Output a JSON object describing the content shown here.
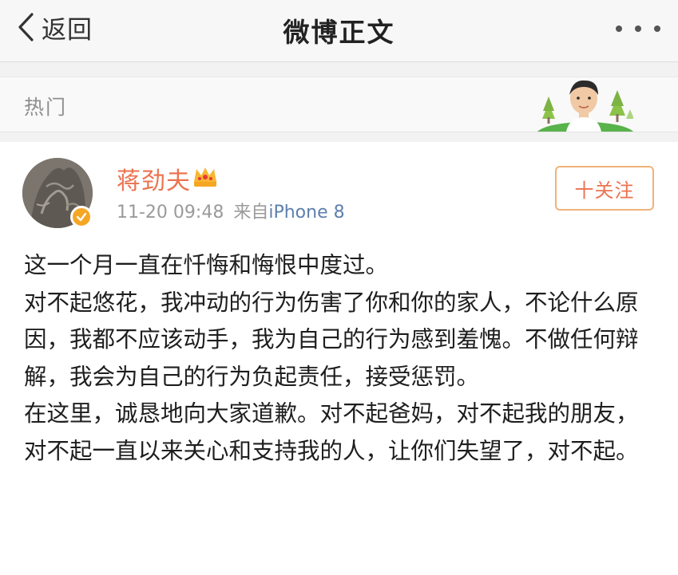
{
  "navbar": {
    "back_label": "返回",
    "title": "微博正文",
    "more_icon": "more-dots-icon"
  },
  "hot": {
    "label": "热门"
  },
  "post": {
    "author": "蒋劲夫",
    "timestamp": "11-20 09:48",
    "source_prefix": "来自",
    "source_name": "iPhone 8",
    "follow_label": "十关注",
    "paragraphs": [
      "这一个月一直在忏悔和悔恨中度过。",
      "对不起悠花，我冲动的行为伤害了你和你的家人，不论什么原因，我都不应该动手，我为自己的行为感到羞愧。不做任何辩解，我会为自己的行为负起责任，接受惩罚。",
      "在这里，诚恳地向大家道歉。对不起爸妈，对不起我的朋友，对不起一直以来关心和支持我的人，让你们失望了，对不起。"
    ]
  },
  "colors": {
    "accent": "#eb7350",
    "source_link": "#5d7fad",
    "badge": "#f5a623"
  }
}
